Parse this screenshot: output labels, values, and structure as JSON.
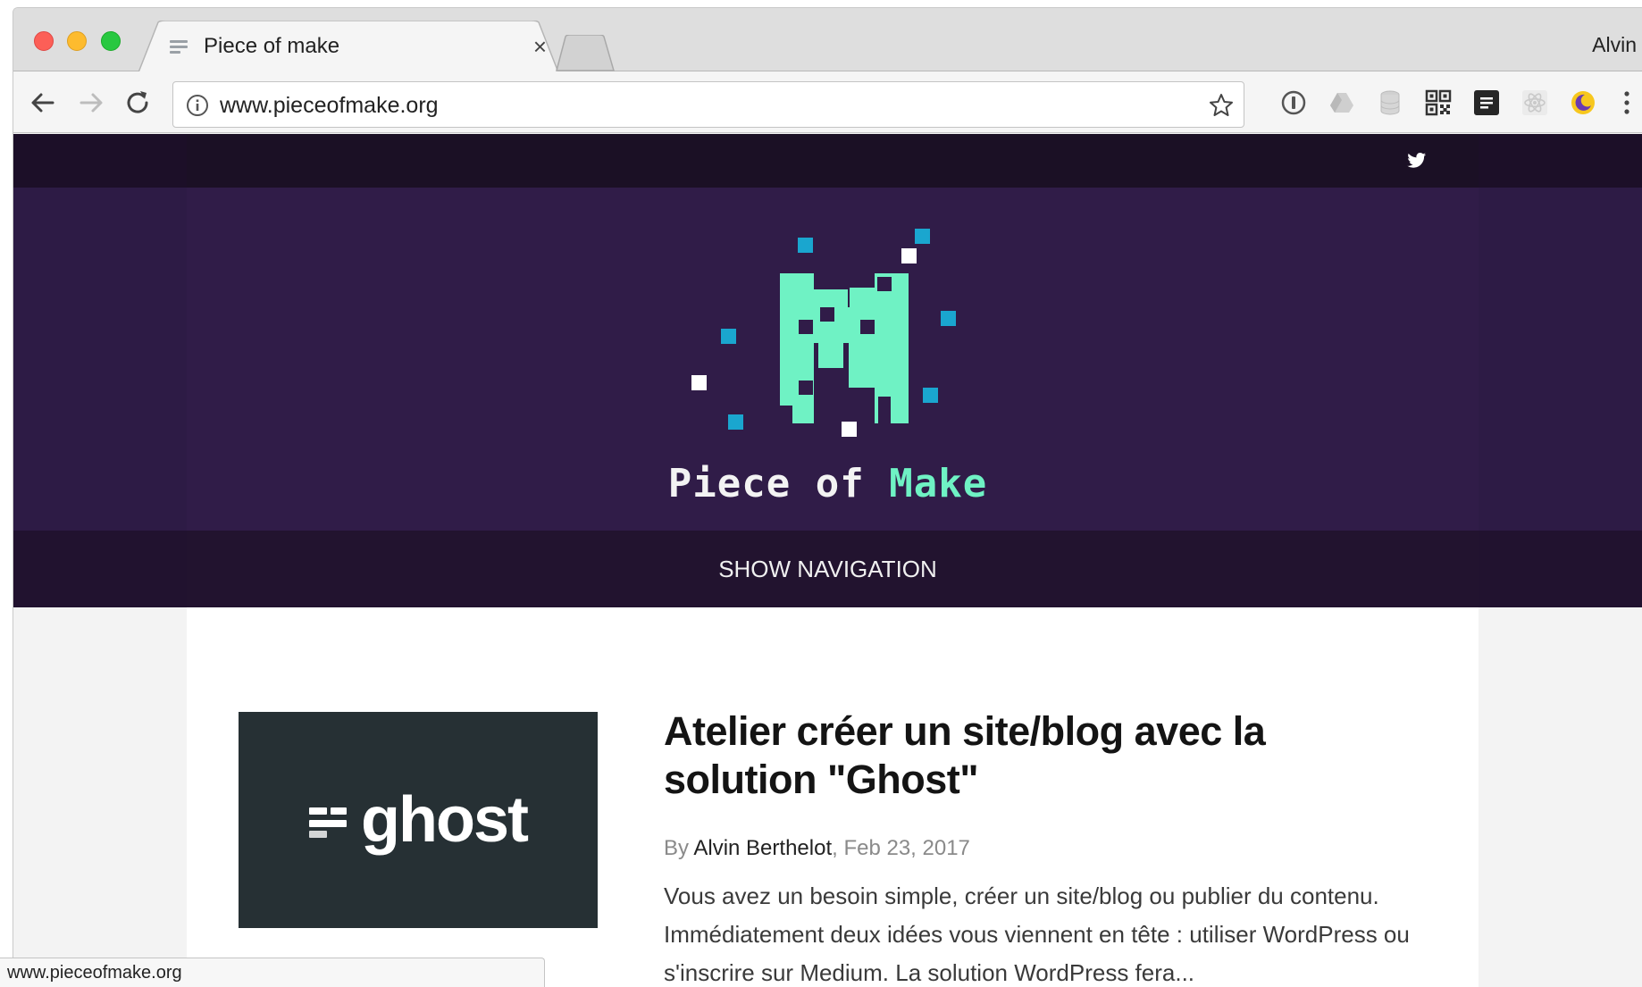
{
  "browser": {
    "tab_title": "Piece of make",
    "profile_name": "Alvin",
    "url": "www.pieceofmake.org",
    "status_url": "www.pieceofmake.org"
  },
  "site": {
    "name_part1": "Piece of ",
    "name_part2": "Make",
    "show_navigation": "SHOW NAVIGATION",
    "colors": {
      "hero": "#301c48",
      "accent": "#6ff2c4",
      "square_blue": "#1aa6cf"
    }
  },
  "post": {
    "image_word": "ghost",
    "title": "Atelier créer un site/blog avec la solution \"Ghost\"",
    "by_label": "By ",
    "author": "Alvin Berthelot",
    "date": ", Feb 23, 2017",
    "excerpt": "Vous avez un besoin simple, créer un site/blog ou publier du contenu. Immédiatement deux idées vous viennent en tête : utiliser WordPress ou s'inscrire sur Medium. La solution WordPress fera..."
  },
  "icons": [
    "back-arrow-icon",
    "forward-arrow-icon",
    "reload-icon",
    "info-icon",
    "star-icon",
    "onepassword-icon",
    "drive-icon",
    "database-icon",
    "qr-code-icon",
    "reader-icon",
    "react-icon",
    "night-mode-icon",
    "more-menu-icon",
    "twitter-icon",
    "ghost-logo-icon"
  ]
}
